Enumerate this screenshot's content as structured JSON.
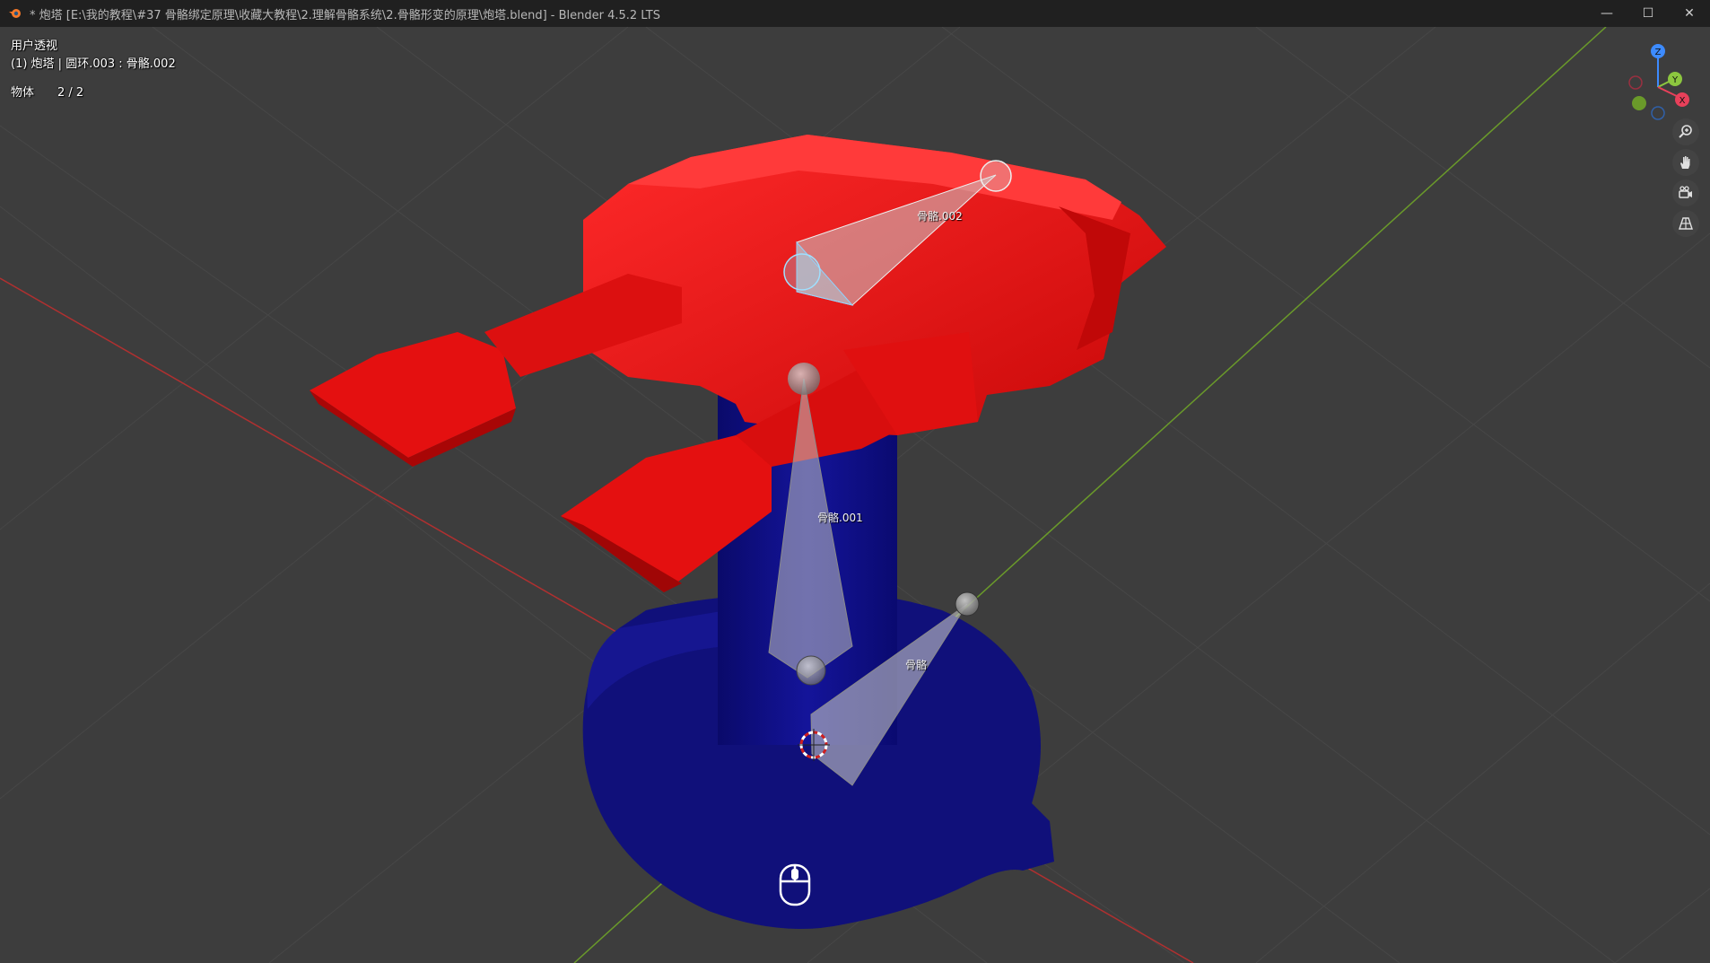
{
  "window": {
    "title": "* 炮塔 [E:\\我的教程\\#37 骨骼绑定原理\\收藏大教程\\2.理解骨骼系统\\2.骨骼形变的原理\\炮塔.blend] - Blender 4.5.2 LTS",
    "controls": {
      "minimize": "—",
      "maximize": "☐",
      "close": "✕"
    }
  },
  "viewport": {
    "view_name": "用户透视",
    "context": "(1) 炮塔 | 圆环.003 : 骨骼.002",
    "stats_label": "物体",
    "stats_value": "2 / 2"
  },
  "bones": [
    {
      "name": "骨骼.002"
    },
    {
      "name": "骨骼.001"
    },
    {
      "name": "骨骼"
    }
  ],
  "gizmo": {
    "axes": {
      "x": "X",
      "y": "Y",
      "z": "Z"
    },
    "colors": {
      "x": "#e8405a",
      "y": "#8cc63f",
      "z": "#3d8bff"
    }
  },
  "nav_tools": [
    "zoom-icon",
    "pan-hand-icon",
    "camera-icon",
    "perspective-grid-icon"
  ],
  "colors": {
    "background": "#3d3d3d",
    "grid": "#474747",
    "x_axis": "#b03030",
    "y_axis": "#6a9a2a",
    "turret_red": "#e81010",
    "base_blue": "#0d0d80"
  }
}
